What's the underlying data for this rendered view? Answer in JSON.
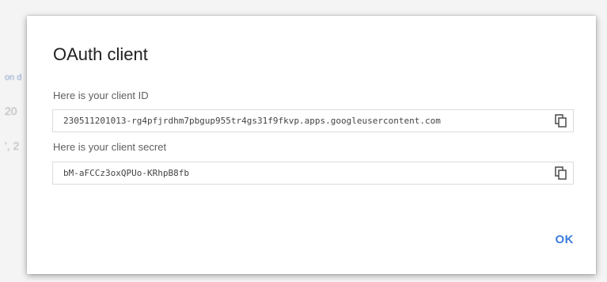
{
  "background": {
    "fragments": [
      "on d",
      "20",
      "', 2"
    ]
  },
  "dialog": {
    "title": "OAuth client",
    "client_id": {
      "label": "Here is your client ID",
      "value": "230511201013-rg4pfjrdhm7pbgup955tr4gs31f9fkvp.apps.googleusercontent.com",
      "copy_icon": "copy-icon"
    },
    "client_secret": {
      "label": "Here is your client secret",
      "value": "bM-aFCCz3oxQPUo-KRhpB8fb",
      "copy_icon": "copy-icon"
    },
    "ok_label": "OK"
  },
  "colors": {
    "accent": "#3b7ddd",
    "title": "#212121",
    "label": "#5f5f5f",
    "border": "#dcdcdc"
  }
}
